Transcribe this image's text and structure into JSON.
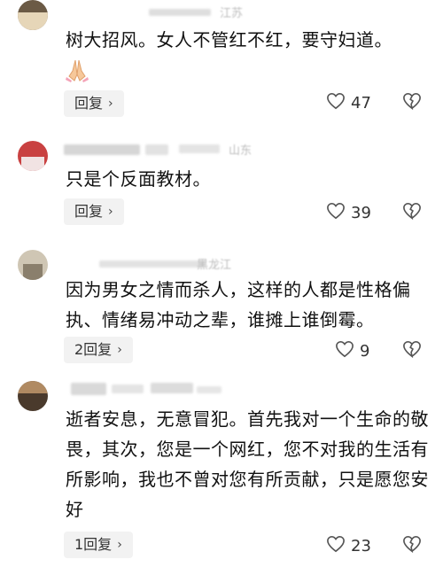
{
  "comments": [
    {
      "text": "树大招风。女人不管红不红，要守妇道。",
      "has_emoji": true,
      "emoji_icon": "praying-hands-icon",
      "meta_suffix": "江苏",
      "reply_label": "回复",
      "likes": "47"
    },
    {
      "text": "只是个反面教材。",
      "meta_suffix": "山东",
      "reply_label": "回复",
      "likes": "39"
    },
    {
      "text": "因为男女之情而杀人，这样的人都是性格偏执、情绪易冲动之辈，谁摊上谁倒霉。",
      "meta_suffix": "黑龙江",
      "reply_label": "2回复",
      "likes": "9"
    },
    {
      "text": "逝者安息，无意冒犯。首先我对一个生命的敬畏，其次，您是一个网红，您不对我的生活有所影响，我也不曾对您有所贡献，只是愿您安好",
      "meta_suffix": "",
      "reply_label": "1回复",
      "likes": "23"
    }
  ],
  "colors": {
    "meta_gray": "#bdbdbd",
    "reply_bg": "#f2f2f2",
    "text": "#111111"
  }
}
